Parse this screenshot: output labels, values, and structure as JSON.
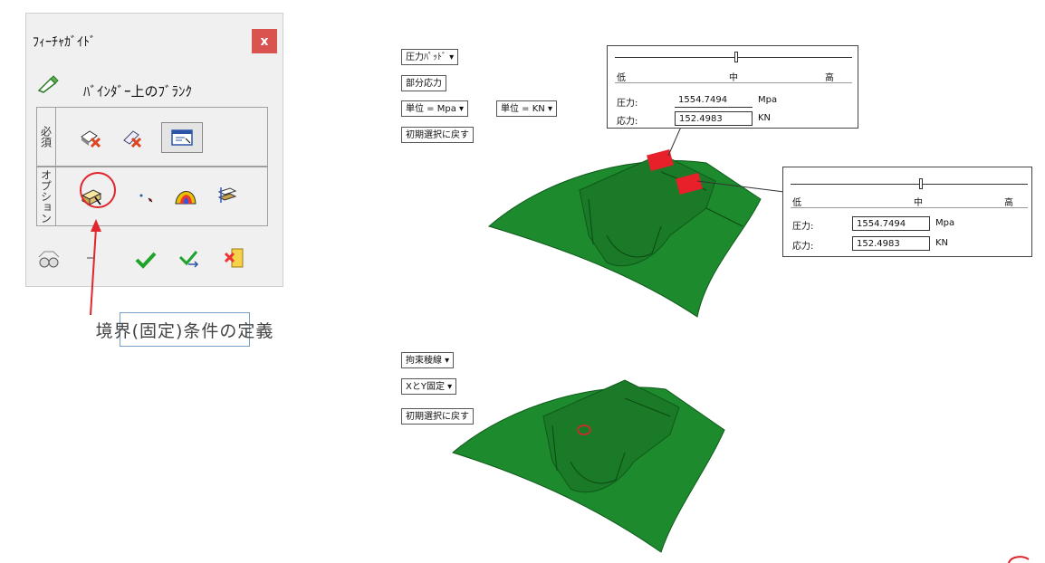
{
  "guide": {
    "title": "ﾌｨｰﾁｬｶﾞｲﾄﾞ",
    "close_label": "x",
    "feature_name": "ﾊﾞｲﾝﾀﾞｰ上のﾌﾞﾗﾝｸ",
    "required_label": "必須",
    "option_label": "オプション"
  },
  "callout": {
    "text": "境界(固定)条件の定義"
  },
  "top_view": {
    "buttons": {
      "pressure_pad": "圧力ﾊﾟｯﾄﾞ ▾",
      "partial_stress": "部分応力",
      "unit_mpa": "単位 = Mpa ▾",
      "unit_kn": "単位 = KN ▾",
      "reset": "初期選択に戻す"
    },
    "panel1": {
      "low": "低",
      "mid": "中",
      "high": "高",
      "pressure_label": "圧力:",
      "pressure_value": "1554.7494",
      "pressure_unit": "Mpa",
      "stress_label": "応力:",
      "stress_value": "152.4983",
      "stress_unit": "KN"
    },
    "panel2": {
      "low": "低",
      "mid": "中",
      "high": "高",
      "pressure_label": "圧力:",
      "pressure_value": "1554.7494",
      "pressure_unit": "Mpa",
      "stress_label": "応力:",
      "stress_value": "152.4983",
      "stress_unit": "KN"
    }
  },
  "bottom_view": {
    "buttons": {
      "constraint_line": "拘束稜線 ▾",
      "xy_fixed": "XとY固定 ▾",
      "reset": "初期選択に戻す"
    }
  },
  "colors": {
    "part": "#1e8a2e",
    "part_dark": "#0d5a19",
    "highlight": "#e8202a",
    "close": "#d9534f"
  }
}
